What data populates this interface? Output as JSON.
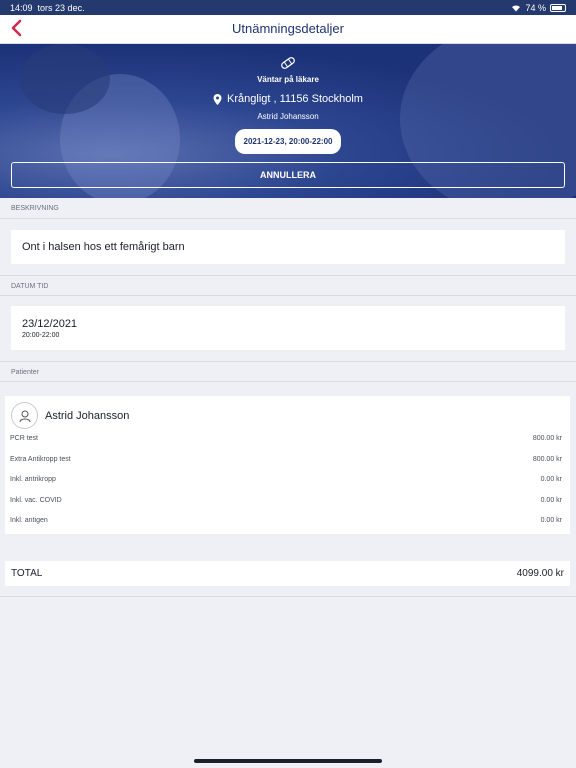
{
  "status_bar": {
    "time": "14:09",
    "date": "tors 23 dec.",
    "battery": "74 %"
  },
  "header": {
    "title": "Utnämningsdetaljer"
  },
  "hero": {
    "status": "Väntar på läkare",
    "address": "Krångligt , 11156 Stockholm",
    "patient": "Astrid Johansson",
    "date_range": "2021-12-23, 20:00-22:00",
    "cancel_label": "ANNULLERA"
  },
  "description": {
    "header": "BESKRIVNING",
    "text": "Ont i halsen hos ett femårigt barn"
  },
  "datetime": {
    "header": "DATUM TID",
    "date": "23/12/2021",
    "time": "20:00-22:00"
  },
  "patients": {
    "header": "Patienter",
    "name": "Astrid Johansson",
    "items": [
      {
        "label": "PCR test",
        "value": "800.00 kr"
      },
      {
        "label": "Extra Antikropp test",
        "value": "800.00 kr"
      },
      {
        "label": "Inkl. antrikropp",
        "value": "0.00 kr"
      },
      {
        "label": "Inkl. vac. COVID",
        "value": "0.00 kr"
      },
      {
        "label": "Inkl. antigen",
        "value": "0.00 kr"
      }
    ]
  },
  "total": {
    "label": "TOTAL",
    "value": "4099.00 kr"
  },
  "colors": {
    "brand": "#1e3470",
    "accent": "#d0284e",
    "background": "#eef0f6"
  },
  "icons": {
    "back": "chevron-left-icon",
    "status": "bandage-icon",
    "location": "pin-icon",
    "patient": "user-avatar-icon"
  }
}
